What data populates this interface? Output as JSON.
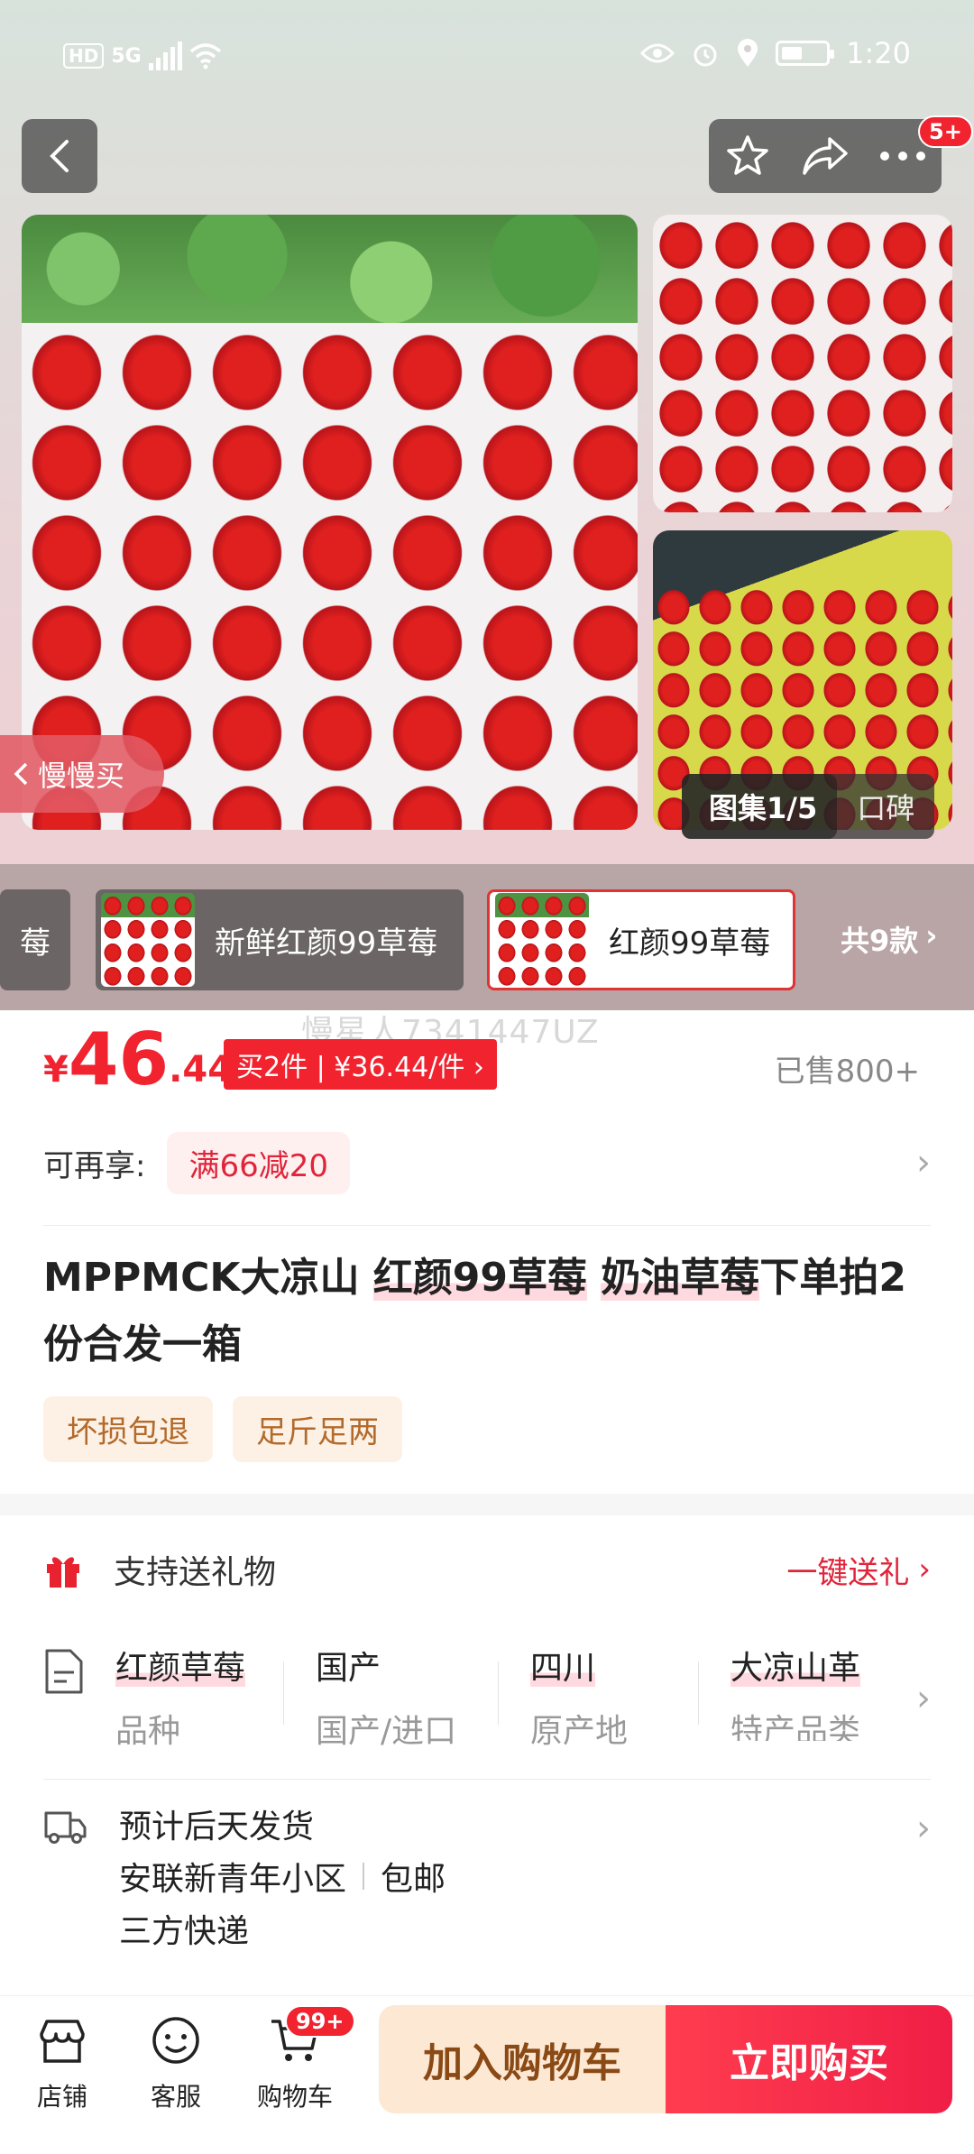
{
  "status_bar": {
    "hd": "HD",
    "network": "5G",
    "time": "1:20"
  },
  "header": {
    "back_icon": "chevron-left",
    "favorite_icon": "star-outline",
    "share_icon": "share-arrow",
    "more_icon": "ellipsis",
    "more_badge": "5+"
  },
  "gallery": {
    "slow_buy_label": "慢慢买",
    "album_label": "图集1/5",
    "reviews_label": "口碑"
  },
  "variants": {
    "items": [
      {
        "label": "莓"
      },
      {
        "label": "新鲜红颜99草莓"
      },
      {
        "label": "红颜99草莓",
        "selected": true
      }
    ],
    "more_label": "共9款"
  },
  "watermark": "慢星人7341447UZ",
  "price": {
    "currency": "¥",
    "integer": "46",
    "decimal": ".44",
    "promo": "买2件 | ¥36.44/件 ›",
    "sold": "已售800+"
  },
  "coupon": {
    "label": "可再享:",
    "value": "满66减20"
  },
  "product": {
    "title_parts": [
      "MPPMCK大凉山 ",
      "红颜99草莓",
      " ",
      "奶油草莓",
      "下单拍2份合发一箱"
    ],
    "tags": [
      "坏损包退",
      "足斤足两"
    ]
  },
  "gift": {
    "label": "支持送礼物",
    "link": "一键送礼"
  },
  "attributes": [
    {
      "value": "红颜草莓",
      "key": "品种"
    },
    {
      "value": "国产",
      "key": "国产/进口"
    },
    {
      "value": "四川",
      "key": "原产地"
    },
    {
      "value": "大凉山革",
      "key": "特产品类"
    }
  ],
  "shipping": {
    "line1": "预计后天发货",
    "address": "安联新青年小区",
    "fee": "包邮",
    "carrier": "三方快递"
  },
  "bottom_bar": {
    "store": "店铺",
    "service": "客服",
    "cart": "购物车",
    "cart_badge": "99+",
    "add_to_cart": "加入购物车",
    "buy_now": "立即购买"
  },
  "colors": {
    "price_red": "#f0232f",
    "add_cart_bg": "#fde8d4",
    "buy_now_bg": "#f01e46"
  }
}
